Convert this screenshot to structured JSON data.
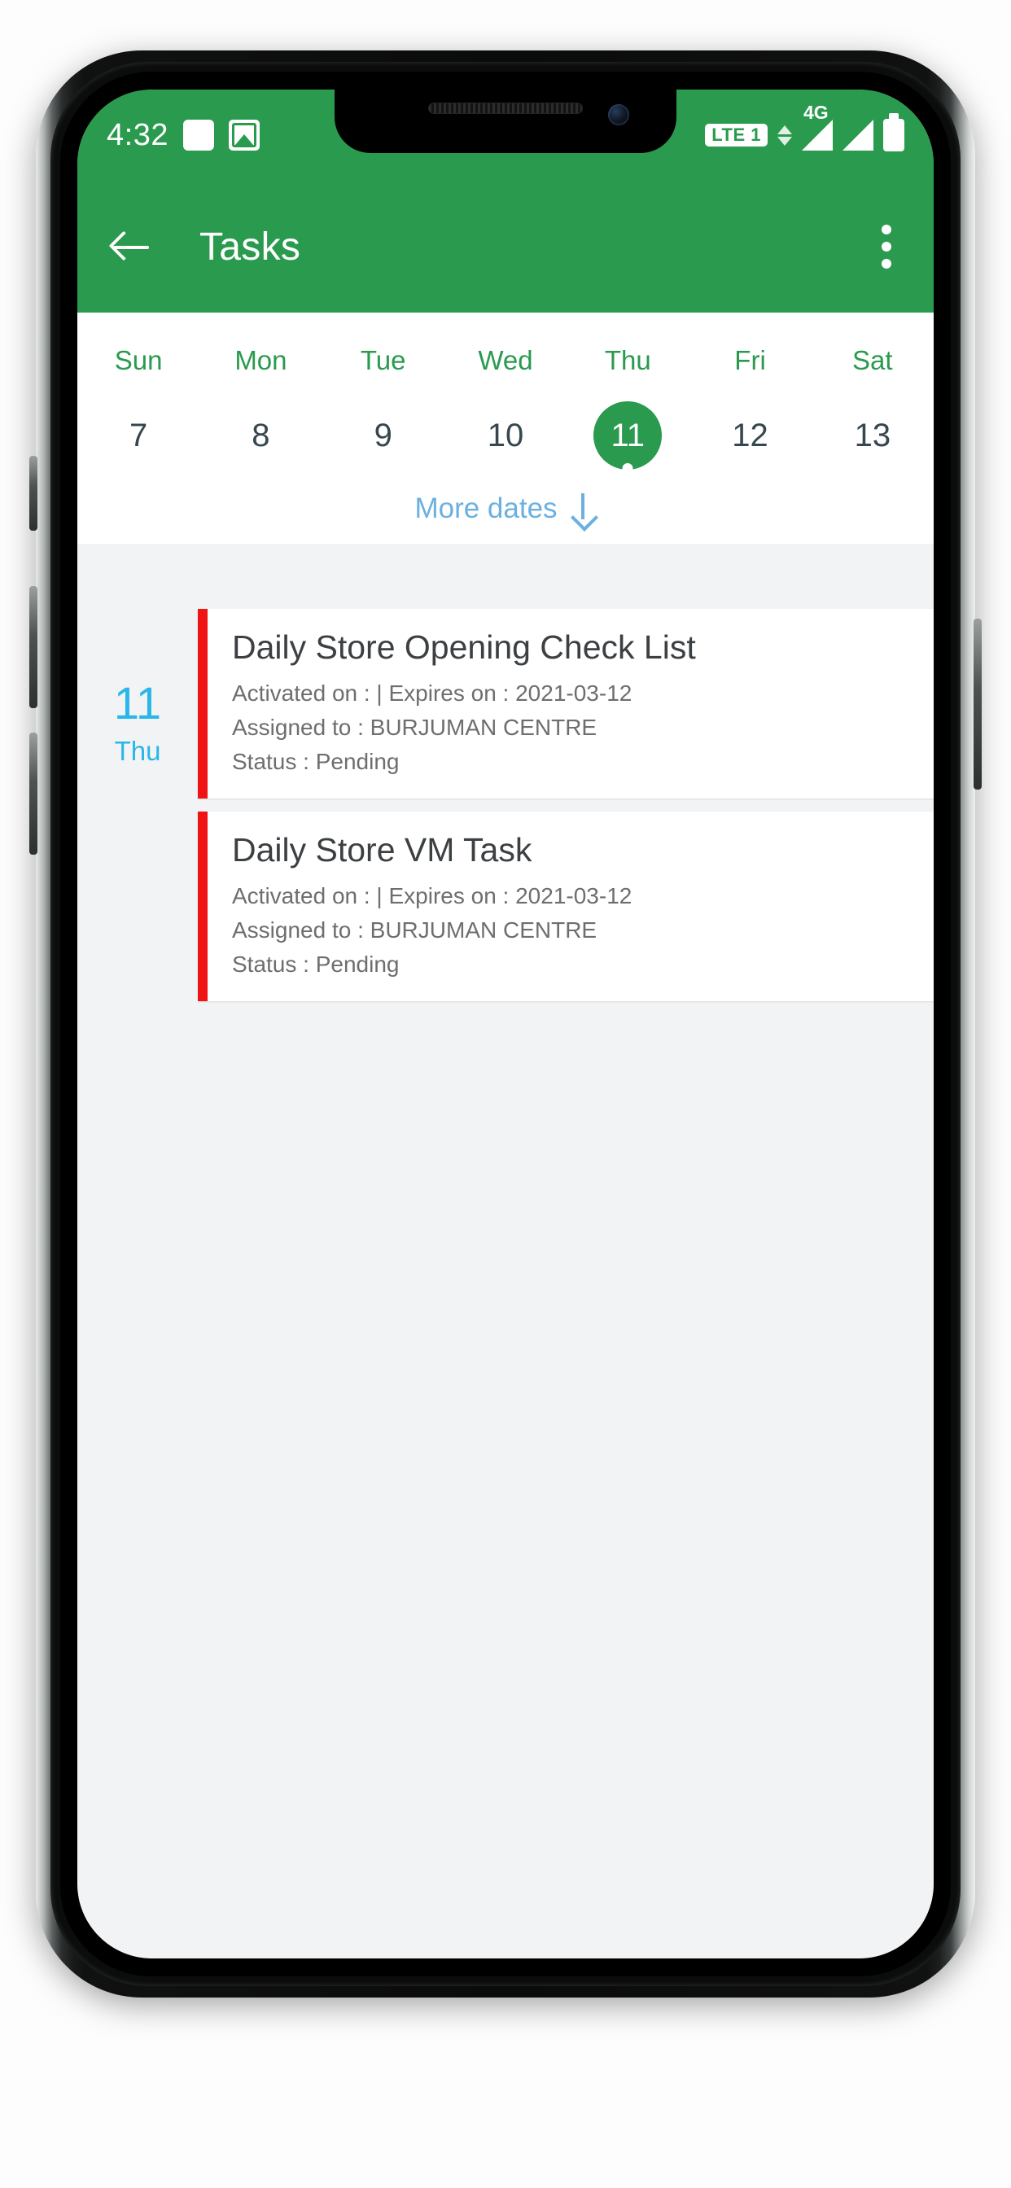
{
  "theme": {
    "green": "#2a9a4e",
    "blue": "#6cb0e0",
    "cyan": "#29b6e8",
    "red": "#f01414",
    "surface": "#ffffff",
    "background": "#f1f3f4"
  },
  "status_bar": {
    "time": "4:32",
    "left_icons": [
      "white-square-icon",
      "image-icon"
    ],
    "carrier_badge": "LTE 1",
    "network_type": "4G",
    "right_icons": [
      "data-transfer-icon",
      "signal-4g-icon",
      "signal-icon",
      "battery-icon"
    ]
  },
  "app_bar": {
    "back_icon": "back-arrow-icon",
    "title": "Tasks",
    "overflow_icon": "overflow-menu-icon"
  },
  "calendar": {
    "day_names": [
      "Sun",
      "Mon",
      "Tue",
      "Wed",
      "Thu",
      "Fri",
      "Sat"
    ],
    "dates": [
      {
        "num": "7",
        "selected": false,
        "has_dot": false
      },
      {
        "num": "8",
        "selected": false,
        "has_dot": false
      },
      {
        "num": "9",
        "selected": false,
        "has_dot": false
      },
      {
        "num": "10",
        "selected": false,
        "has_dot": false
      },
      {
        "num": "11",
        "selected": true,
        "has_dot": true
      },
      {
        "num": "12",
        "selected": false,
        "has_dot": false
      },
      {
        "num": "13",
        "selected": false,
        "has_dot": false
      }
    ],
    "more_dates_label": "More dates",
    "more_dates_icon": "arrow-down-icon"
  },
  "task_list": {
    "day_marker": {
      "number": "11",
      "weekday": "Thu"
    },
    "tasks": [
      {
        "title": "Daily Store Opening Check List",
        "activated_expires": "Activated on :  | Expires on : 2021-03-12",
        "assigned_to": "Assigned to :  BURJUMAN CENTRE",
        "status": "Status : Pending",
        "stripe_color": "#f01414"
      },
      {
        "title": "Daily Store VM Task",
        "activated_expires": "Activated on :  | Expires on : 2021-03-12",
        "assigned_to": "Assigned to :  BURJUMAN CENTRE",
        "status": "Status : Pending",
        "stripe_color": "#f01414"
      }
    ]
  }
}
